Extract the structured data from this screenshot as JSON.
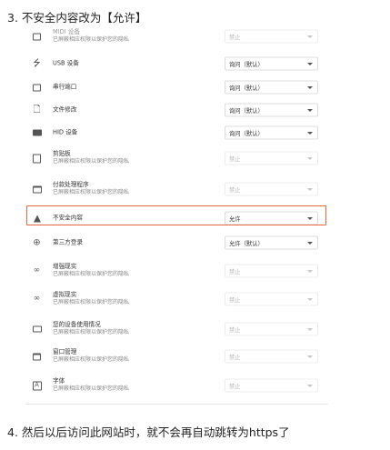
{
  "headings": {
    "step3": "3. 不安全内容改为【允许】",
    "step4": "4. 然后以后访问此网站时，就不会再自动跳转为https了"
  },
  "rows": [
    {
      "title": "MIDI 设备",
      "subtitle": "已屏蔽相应权限以保护您的隐私",
      "value": "禁止",
      "icon": "midi-icon",
      "disabled": true
    },
    {
      "title": "USB 设备",
      "subtitle": "",
      "value": "询问（默认）",
      "icon": "usb-icon",
      "disabled": false
    },
    {
      "title": "串行端口",
      "subtitle": "",
      "value": "询问（默认）",
      "icon": "serial-port-icon",
      "disabled": false
    },
    {
      "title": "文件修改",
      "subtitle": "",
      "value": "询问（默认）",
      "icon": "file-edit-icon",
      "disabled": false
    },
    {
      "title": "HID 设备",
      "subtitle": "",
      "value": "询问（默认）",
      "icon": "hid-device-icon",
      "disabled": false
    },
    {
      "title": "剪贴板",
      "subtitle": "已屏蔽相应权限以保护您的隐私",
      "value": "禁止",
      "icon": "clipboard-icon",
      "disabled": true
    },
    {
      "title": "付款处理程序",
      "subtitle": "已屏蔽相应权限以保护您的隐私",
      "value": "禁止",
      "icon": "payment-icon",
      "disabled": true
    },
    {
      "title": "不安全内容",
      "subtitle": "",
      "value": "允许",
      "icon": "warning-icon",
      "disabled": false
    },
    {
      "title": "第三方登录",
      "subtitle": "",
      "value": "允许（默认）",
      "icon": "third-party-signin-icon",
      "disabled": false
    },
    {
      "title": "增强现实",
      "subtitle": "已屏蔽相应权限以保护您的隐私",
      "value": "禁止",
      "icon": "ar-icon",
      "disabled": true
    },
    {
      "title": "虚拟现实",
      "subtitle": "已屏蔽相应权限以保护您的隐私",
      "value": "禁止",
      "icon": "vr-icon",
      "disabled": true
    },
    {
      "title": "您的设备使用情况",
      "subtitle": "已屏蔽相应权限以保护您的隐私",
      "value": "禁止",
      "icon": "device-usage-icon",
      "disabled": true
    },
    {
      "title": "窗口管理",
      "subtitle": "已屏蔽相应权限以保护您的隐私",
      "value": "禁止",
      "icon": "window-management-icon",
      "disabled": true
    },
    {
      "title": "字体",
      "subtitle": "已屏蔽相应权限以保护您的隐私",
      "value": "禁止",
      "icon": "font-icon",
      "disabled": true
    }
  ],
  "highlight_color": "#e8663d"
}
